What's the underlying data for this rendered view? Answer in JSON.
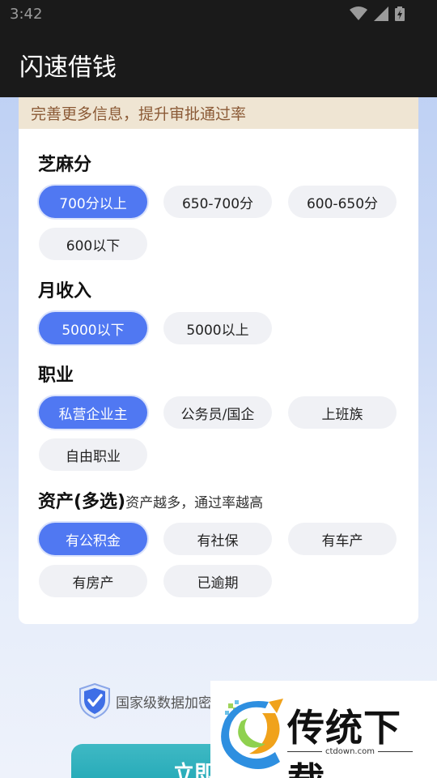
{
  "status": {
    "time": "3:42"
  },
  "app": {
    "title": "闪速借钱"
  },
  "banner": {
    "text": "完善更多信息，提升审批通过率"
  },
  "sections": [
    {
      "title": "芝麻分",
      "hint": "",
      "options": [
        "700分以上",
        "650-700分",
        "600-650分",
        "600以下"
      ],
      "selected": [
        0
      ]
    },
    {
      "title": "月收入",
      "hint": "",
      "options": [
        "5000以下",
        "5000以上"
      ],
      "selected": [
        0
      ]
    },
    {
      "title": "职业",
      "hint": "",
      "options": [
        "私营企业主",
        "公务员/国企",
        "上班族",
        "自由职业"
      ],
      "selected": [
        0
      ]
    },
    {
      "title": "资产(多选)",
      "hint": "资产越多，通过率越高",
      "options": [
        "有公积金",
        "有社保",
        "有车产",
        "有房产",
        "已逾期"
      ],
      "selected": [
        0
      ]
    }
  ],
  "security": {
    "text": "国家级数据加密"
  },
  "submit": {
    "label": "立即"
  },
  "watermark": {
    "brand": "传统下载",
    "url": "ctdown.com"
  },
  "colors": {
    "accent": "#5078f2",
    "banner_text": "#8b5a36",
    "button": "#1aa3b2"
  }
}
